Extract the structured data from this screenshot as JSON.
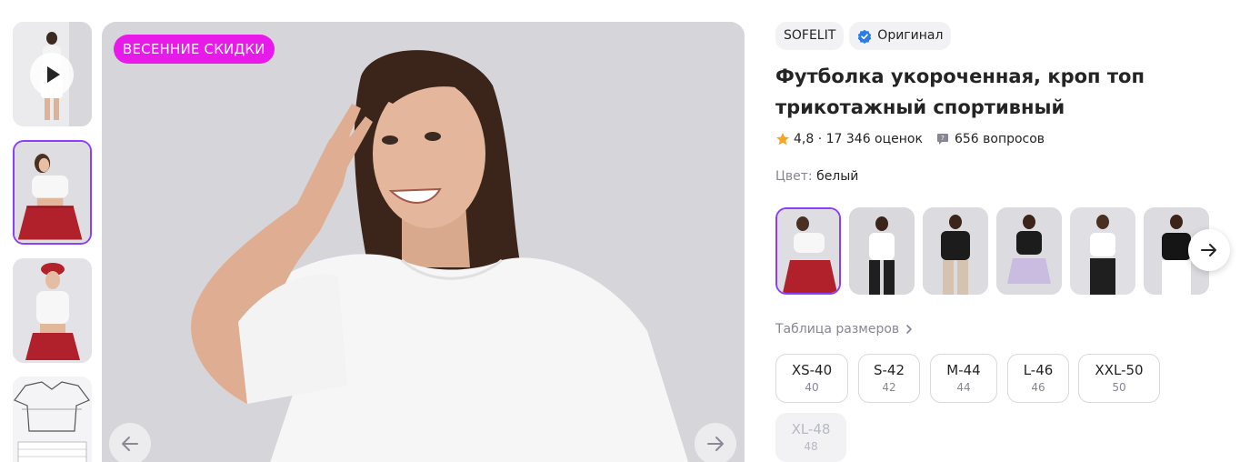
{
  "promo_label": "ВЕСЕННИЕ СКИДКИ",
  "brand": "SOFELIT",
  "original_label": "Оригинал",
  "title": "Футболка укороченная, кроп топ трикотажный спортивный",
  "rating": "4,8",
  "rating_sep": " · ",
  "reviews": "17 346 оценок",
  "questions": "656 вопросов",
  "color_label": "Цвет:",
  "color_value": "белый",
  "size_table_label": "Таблица размеров",
  "sizes": [
    {
      "label": "XS-40",
      "sub": "40",
      "available": true
    },
    {
      "label": "S-42",
      "sub": "42",
      "available": true
    },
    {
      "label": "M-44",
      "sub": "44",
      "available": true
    },
    {
      "label": "L-46",
      "sub": "46",
      "available": true
    },
    {
      "label": "XXL-50",
      "sub": "50",
      "available": true
    },
    {
      "label": "XL-48",
      "sub": "48",
      "available": false
    }
  ],
  "colors": {
    "accent": "#8b3ffd",
    "promo": "#e81ae9",
    "star": "#f5a623",
    "verified": "#2c7ce6"
  },
  "icons": [
    "play-icon",
    "arrow-left-icon",
    "arrow-right-icon",
    "star-icon",
    "question-icon",
    "verified-check-icon",
    "chevron-right-icon"
  ]
}
